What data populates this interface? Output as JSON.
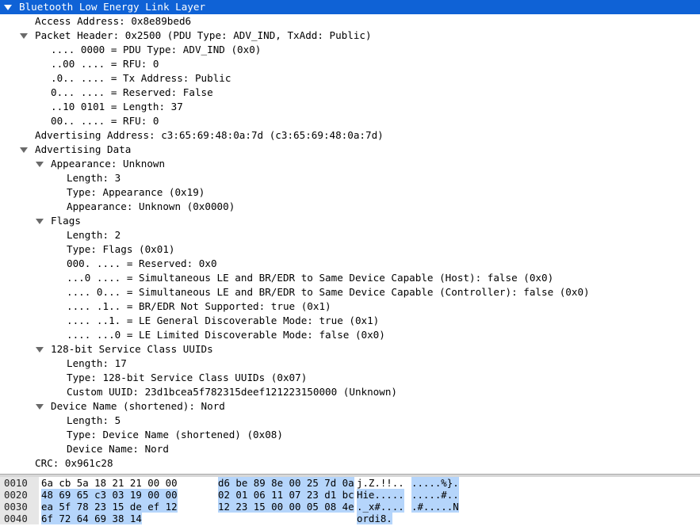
{
  "tree": [
    {
      "text": "Bluetooth Low Energy Link Layer",
      "level": 0,
      "toggle": "expanded",
      "selected": true,
      "name": "tree-row-ble-link-layer"
    },
    {
      "text": "Access Address: 0x8e89bed6",
      "level": 1,
      "toggle": "none",
      "name": "tree-row-access-address"
    },
    {
      "text": "Packet Header: 0x2500 (PDU Type: ADV_IND, TxAdd: Public)",
      "level": 1,
      "toggle": "expanded",
      "name": "tree-row-packet-header"
    },
    {
      "text": ".... 0000 = PDU Type: ADV_IND (0x0)",
      "level": 2,
      "toggle": "none",
      "name": "tree-row-pdu-type"
    },
    {
      "text": "..00 .... = RFU: 0",
      "level": 2,
      "toggle": "none",
      "name": "tree-row-rfu-1"
    },
    {
      "text": ".0.. .... = Tx Address: Public",
      "level": 2,
      "toggle": "none",
      "name": "tree-row-tx-address"
    },
    {
      "text": "0... .... = Reserved: False",
      "level": 2,
      "toggle": "none",
      "name": "tree-row-reserved"
    },
    {
      "text": "..10 0101 = Length: 37",
      "level": 2,
      "toggle": "none",
      "name": "tree-row-length"
    },
    {
      "text": "00.. .... = RFU: 0",
      "level": 2,
      "toggle": "none",
      "name": "tree-row-rfu-2"
    },
    {
      "text": "Advertising Address: c3:65:69:48:0a:7d (c3:65:69:48:0a:7d)",
      "level": 1,
      "toggle": "none",
      "name": "tree-row-advertising-address"
    },
    {
      "text": "Advertising Data",
      "level": 1,
      "toggle": "expanded",
      "name": "tree-row-advertising-data"
    },
    {
      "text": "Appearance: Unknown",
      "level": 2,
      "toggle": "expanded",
      "name": "tree-row-appearance"
    },
    {
      "text": "Length: 3",
      "level": 3,
      "toggle": "none",
      "name": "tree-row-appearance-length"
    },
    {
      "text": "Type: Appearance (0x19)",
      "level": 3,
      "toggle": "none",
      "name": "tree-row-appearance-type"
    },
    {
      "text": "Appearance: Unknown (0x0000)",
      "level": 3,
      "toggle": "none",
      "name": "tree-row-appearance-value"
    },
    {
      "text": "Flags",
      "level": 2,
      "toggle": "expanded",
      "name": "tree-row-flags"
    },
    {
      "text": "Length: 2",
      "level": 3,
      "toggle": "none",
      "name": "tree-row-flags-length"
    },
    {
      "text": "Type: Flags (0x01)",
      "level": 3,
      "toggle": "none",
      "name": "tree-row-flags-type"
    },
    {
      "text": "000. .... = Reserved: 0x0",
      "level": 3,
      "toggle": "none",
      "name": "tree-row-flags-reserved"
    },
    {
      "text": "...0 .... = Simultaneous LE and BR/EDR to Same Device Capable (Host): false (0x0)",
      "level": 3,
      "toggle": "none",
      "name": "tree-row-flags-host"
    },
    {
      "text": ".... 0... = Simultaneous LE and BR/EDR to Same Device Capable (Controller): false (0x0)",
      "level": 3,
      "toggle": "none",
      "name": "tree-row-flags-controller"
    },
    {
      "text": ".... .1.. = BR/EDR Not Supported: true (0x1)",
      "level": 3,
      "toggle": "none",
      "name": "tree-row-flags-bredr"
    },
    {
      "text": ".... ..1. = LE General Discoverable Mode: true (0x1)",
      "level": 3,
      "toggle": "none",
      "name": "tree-row-flags-general"
    },
    {
      "text": ".... ...0 = LE Limited Discoverable Mode: false (0x0)",
      "level": 3,
      "toggle": "none",
      "name": "tree-row-flags-limited"
    },
    {
      "text": "128-bit Service Class UUIDs",
      "level": 2,
      "toggle": "expanded",
      "name": "tree-row-uuids"
    },
    {
      "text": "Length: 17",
      "level": 3,
      "toggle": "none",
      "name": "tree-row-uuids-length"
    },
    {
      "text": "Type: 128-bit Service Class UUIDs (0x07)",
      "level": 3,
      "toggle": "none",
      "name": "tree-row-uuids-type"
    },
    {
      "text": "Custom UUID: 23d1bcea5f782315deef121223150000 (Unknown)",
      "level": 3,
      "toggle": "none",
      "name": "tree-row-uuids-custom"
    },
    {
      "text": "Device Name (shortened): Nord",
      "level": 2,
      "toggle": "expanded",
      "name": "tree-row-device-name"
    },
    {
      "text": "Length: 5",
      "level": 3,
      "toggle": "none",
      "name": "tree-row-device-name-length"
    },
    {
      "text": "Type: Device Name (shortened) (0x08)",
      "level": 3,
      "toggle": "none",
      "name": "tree-row-device-name-type"
    },
    {
      "text": "Device Name: Nord",
      "level": 3,
      "toggle": "none",
      "name": "tree-row-device-name-value"
    },
    {
      "text": "CRC: 0x961c28",
      "level": 1,
      "toggle": "none",
      "name": "tree-row-crc"
    }
  ],
  "hex": [
    {
      "offset": "0010",
      "hex_a": "6a cb 5a 18 21 21 00 00",
      "hex_b": "d6 be 89 8e 00 25 7d 0a",
      "ascii_a": "j.Z.!!..",
      "ascii_b": ".....%}.",
      "hl_a": false,
      "hl_b": true
    },
    {
      "offset": "0020",
      "hex_a": "48 69 65 c3 03 19 00 00",
      "hex_b": "02 01 06 11 07 23 d1 bc",
      "ascii_a": "Hie.....",
      "ascii_b": ".....#..",
      "hl_a": true,
      "hl_b": true
    },
    {
      "offset": "0030",
      "hex_a": "ea 5f 78 23 15 de ef 12",
      "hex_b": "12 23 15 00 00 05 08 4e",
      "ascii_a": "._x#....",
      "ascii_b": ".#.....N",
      "hl_a": true,
      "hl_b": true
    },
    {
      "offset": "0040",
      "hex_a": "6f 72 64 69 38 14",
      "hex_b": "",
      "ascii_a": "ordi8.",
      "ascii_b": "",
      "hl_a": true,
      "hl_b": false
    }
  ],
  "colors": {
    "selection": "#0f62d6",
    "byte_highlight": "#b5d5fb",
    "offset_gutter": "#e6e6e6"
  }
}
